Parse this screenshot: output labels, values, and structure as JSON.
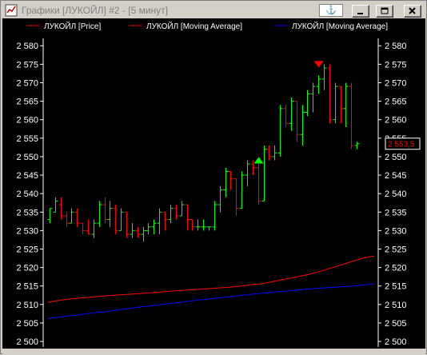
{
  "window": {
    "title": "Графики [ЛУКОЙЛ] #2 - [5 минут]",
    "anchor_symbol": "⚓"
  },
  "colors": {
    "background": "#000000",
    "up_bar": "#00ff00",
    "down_bar": "#ff0000",
    "ma1": "#ff0000",
    "ma2": "#0000ff",
    "axis": "#ffffff",
    "buy_marker": "#00ff00",
    "sell_marker": "#ff0000"
  },
  "icons": {
    "app": "chart-app-icon",
    "anchor": "anchor-icon",
    "minimize": "minimize-icon",
    "maximize": "maximize-icon",
    "close": "close-icon"
  },
  "chart_data": {
    "type": "ohlc",
    "legend": [
      {
        "name": "ЛУКОЙЛ [Price]",
        "color": "#ff0000"
      },
      {
        "name": "ЛУКОЙЛ [Moving Average]",
        "color": "#ff0000"
      },
      {
        "name": "ЛУКОЙЛ [Moving Average]",
        "color": "#0000ff"
      }
    ],
    "y_ticks": [
      "2 500",
      "2 505",
      "2 510",
      "2 515",
      "2 520",
      "2 525",
      "2 530",
      "2 535",
      "2 540",
      "2 545",
      "2 550",
      "2 555",
      "2 560",
      "2 565",
      "2 570",
      "2 575",
      "2 580"
    ],
    "y_tick_values": [
      2500,
      2505,
      2510,
      2515,
      2520,
      2525,
      2530,
      2535,
      2540,
      2545,
      2550,
      2555,
      2560,
      2565,
      2570,
      2575,
      2580
    ],
    "ylim": [
      2498.5,
      2582.0
    ],
    "last_price_label": "2 553,5",
    "last_price": 2553.5,
    "bars": [
      {
        "o": 2533,
        "h": 2536,
        "l": 2532,
        "c": 2536
      },
      {
        "o": 2535,
        "h": 2539,
        "l": 2535,
        "c": 2538
      },
      {
        "o": 2537,
        "h": 2539,
        "l": 2533,
        "c": 2534
      },
      {
        "o": 2534,
        "h": 2535,
        "l": 2531,
        "c": 2532
      },
      {
        "o": 2532,
        "h": 2536,
        "l": 2532,
        "c": 2535
      },
      {
        "o": 2535,
        "h": 2536,
        "l": 2531,
        "c": 2532
      },
      {
        "o": 2532,
        "h": 2532,
        "l": 2529,
        "c": 2530
      },
      {
        "o": 2530,
        "h": 2533,
        "l": 2529,
        "c": 2529
      },
      {
        "o": 2529,
        "h": 2533,
        "l": 2528,
        "c": 2532
      },
      {
        "o": 2532,
        "h": 2538,
        "l": 2531,
        "c": 2537
      },
      {
        "o": 2537,
        "h": 2539,
        "l": 2532,
        "c": 2533
      },
      {
        "o": 2533,
        "h": 2538,
        "l": 2531,
        "c": 2536
      },
      {
        "o": 2536,
        "h": 2537,
        "l": 2529,
        "c": 2530
      },
      {
        "o": 2530,
        "h": 2536,
        "l": 2530,
        "c": 2535
      },
      {
        "o": 2535,
        "h": 2535,
        "l": 2528,
        "c": 2529
      },
      {
        "o": 2529,
        "h": 2532,
        "l": 2528,
        "c": 2530
      },
      {
        "o": 2530,
        "h": 2531,
        "l": 2528,
        "c": 2529
      },
      {
        "o": 2529,
        "h": 2531,
        "l": 2527,
        "c": 2530
      },
      {
        "o": 2530,
        "h": 2532,
        "l": 2529,
        "c": 2531
      },
      {
        "o": 2531,
        "h": 2533,
        "l": 2529,
        "c": 2532
      },
      {
        "o": 2532,
        "h": 2536,
        "l": 2529,
        "c": 2535
      },
      {
        "o": 2535,
        "h": 2535,
        "l": 2530,
        "c": 2533
      },
      {
        "o": 2533,
        "h": 2537,
        "l": 2532,
        "c": 2536
      },
      {
        "o": 2536,
        "h": 2537,
        "l": 2533,
        "c": 2534
      },
      {
        "o": 2534,
        "h": 2538,
        "l": 2534,
        "c": 2537
      },
      {
        "o": 2537,
        "h": 2537,
        "l": 2530,
        "c": 2533
      },
      {
        "o": 2533,
        "h": 2533,
        "l": 2530,
        "c": 2531
      },
      {
        "o": 2531,
        "h": 2533,
        "l": 2530,
        "c": 2531
      },
      {
        "o": 2531,
        "h": 2533,
        "l": 2530,
        "c": 2531
      },
      {
        "o": 2531,
        "h": 2531,
        "l": 2530,
        "c": 2531
      },
      {
        "o": 2531,
        "h": 2538,
        "l": 2530,
        "c": 2537
      },
      {
        "o": 2537,
        "h": 2542,
        "l": 2535,
        "c": 2541
      },
      {
        "o": 2541,
        "h": 2547,
        "l": 2539,
        "c": 2546
      },
      {
        "o": 2546,
        "h": 2546,
        "l": 2541,
        "c": 2544
      },
      {
        "o": 2544,
        "h": 2544,
        "l": 2534,
        "c": 2536
      },
      {
        "o": 2536,
        "h": 2546,
        "l": 2536,
        "c": 2545
      },
      {
        "o": 2545,
        "h": 2549,
        "l": 2542,
        "c": 2548
      },
      {
        "o": 2548,
        "h": 2549,
        "l": 2545,
        "c": 2547
      },
      {
        "o": 2547,
        "h": 2548,
        "l": 2537,
        "c": 2538
      },
      {
        "o": 2538,
        "h": 2553,
        "l": 2538,
        "c": 2552
      },
      {
        "o": 2552,
        "h": 2553,
        "l": 2549,
        "c": 2550
      },
      {
        "o": 2550,
        "h": 2553,
        "l": 2549,
        "c": 2551
      },
      {
        "o": 2551,
        "h": 2564,
        "l": 2550,
        "c": 2563
      },
      {
        "o": 2563,
        "h": 2564,
        "l": 2558,
        "c": 2559
      },
      {
        "o": 2559,
        "h": 2566,
        "l": 2557,
        "c": 2565
      },
      {
        "o": 2565,
        "h": 2565,
        "l": 2554,
        "c": 2556
      },
      {
        "o": 2556,
        "h": 2564,
        "l": 2553,
        "c": 2562
      },
      {
        "o": 2562,
        "h": 2568,
        "l": 2561,
        "c": 2567
      },
      {
        "o": 2567,
        "h": 2570,
        "l": 2562,
        "c": 2569
      },
      {
        "o": 2569,
        "h": 2572,
        "l": 2567,
        "c": 2571
      },
      {
        "o": 2571,
        "h": 2575,
        "l": 2568,
        "c": 2574
      },
      {
        "o": 2574,
        "h": 2575,
        "l": 2559,
        "c": 2560
      },
      {
        "o": 2560,
        "h": 2570,
        "l": 2559,
        "c": 2569
      },
      {
        "o": 2569,
        "h": 2569,
        "l": 2559,
        "c": 2563
      },
      {
        "o": 2563,
        "h": 2570,
        "l": 2558,
        "c": 2569
      },
      {
        "o": 2569,
        "h": 2570,
        "l": 2552,
        "c": 2553
      },
      {
        "o": 2553,
        "h": 2554,
        "l": 2552,
        "c": 2553.5
      }
    ],
    "ma_red": [
      2510.6,
      2510.9,
      2511.1,
      2511.3,
      2511.5,
      2511.6,
      2511.8,
      2511.9,
      2512.0,
      2512.2,
      2512.3,
      2512.4,
      2512.5,
      2512.6,
      2512.7,
      2512.8,
      2512.9,
      2513.0,
      2513.1,
      2513.2,
      2513.3,
      2513.5,
      2513.6,
      2513.7,
      2513.8,
      2513.9,
      2514.0,
      2514.1,
      2514.2,
      2514.3,
      2514.4,
      2514.5,
      2514.6,
      2514.7,
      2514.9,
      2515.0,
      2515.2,
      2515.4,
      2515.5,
      2515.7,
      2516.0,
      2516.3,
      2516.6,
      2516.9,
      2517.2,
      2517.5,
      2517.8,
      2518.1,
      2518.5,
      2518.9,
      2519.3,
      2519.8,
      2520.2,
      2520.7,
      2521.2,
      2521.7,
      2522.1,
      2522.6,
      2522.9,
      2523.1
    ],
    "ma_blue": [
      2506.2,
      2506.4,
      2506.6,
      2506.8,
      2507.0,
      2507.1,
      2507.3,
      2507.5,
      2507.7,
      2507.9,
      2508.0,
      2508.2,
      2508.4,
      2508.6,
      2508.8,
      2509.0,
      2509.2,
      2509.4,
      2509.5,
      2509.7,
      2509.9,
      2510.1,
      2510.3,
      2510.4,
      2510.6,
      2510.8,
      2511.0,
      2511.2,
      2511.3,
      2511.5,
      2511.6,
      2511.8,
      2512.0,
      2512.1,
      2512.3,
      2512.5,
      2512.6,
      2512.8,
      2512.9,
      2513.1,
      2513.2,
      2513.4,
      2513.5,
      2513.6,
      2513.8,
      2513.9,
      2514.0,
      2514.2,
      2514.3,
      2514.4,
      2514.5,
      2514.6,
      2514.7,
      2514.8,
      2514.9,
      2515.0,
      2515.1,
      2515.3,
      2515.4,
      2515.6
    ],
    "signals": [
      {
        "type": "buy",
        "bar": 38,
        "price": 2549
      },
      {
        "type": "sell",
        "bar": 49,
        "price": 2575
      }
    ]
  }
}
